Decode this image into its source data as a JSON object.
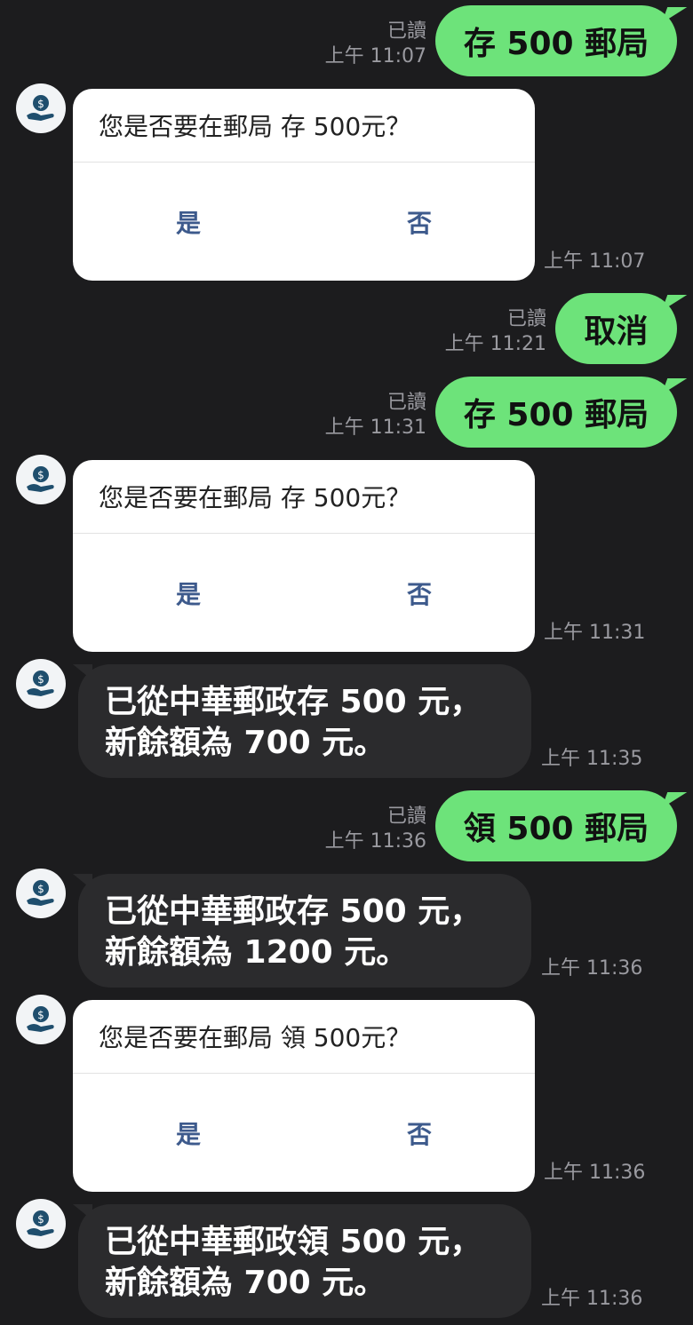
{
  "colors": {
    "background": "#1c1c1e",
    "outgoing": "#6de37a",
    "incoming": "#2b2b2d",
    "card": "#ffffff",
    "button_text": "#3d5a8c"
  },
  "avatar_icon": "piggy-bank-hand-icon",
  "messages": [
    {
      "type": "out",
      "text": "存 500 郵局",
      "read": "已讀",
      "time": "上午 11:07"
    },
    {
      "type": "card",
      "question": "您是否要在郵局 存 500元？",
      "yes": "是",
      "no": "否",
      "time": "上午 11:07"
    },
    {
      "type": "out",
      "text": "取消",
      "read": "已讀",
      "time": "上午 11:21"
    },
    {
      "type": "out",
      "text": "存 500 郵局",
      "read": "已讀",
      "time": "上午 11:31"
    },
    {
      "type": "card",
      "question": "您是否要在郵局 存 500元？",
      "yes": "是",
      "no": "否",
      "time": "上午 11:31"
    },
    {
      "type": "in",
      "line1": "已從中華郵政存 500 元，",
      "line2": "新餘額為 700 元。",
      "time": "上午 11:35"
    },
    {
      "type": "out",
      "text": "領 500 郵局",
      "read": "已讀",
      "time": "上午 11:36"
    },
    {
      "type": "in",
      "line1": "已從中華郵政存 500 元，",
      "line2": "新餘額為 1200 元。",
      "time": "上午 11:36"
    },
    {
      "type": "card",
      "question": "您是否要在郵局 領 500元？",
      "yes": "是",
      "no": "否",
      "time": "上午 11:36"
    },
    {
      "type": "in",
      "line1": "已從中華郵政領 500 元，",
      "line2": "新餘額為 700 元。",
      "time": "上午 11:36"
    }
  ]
}
